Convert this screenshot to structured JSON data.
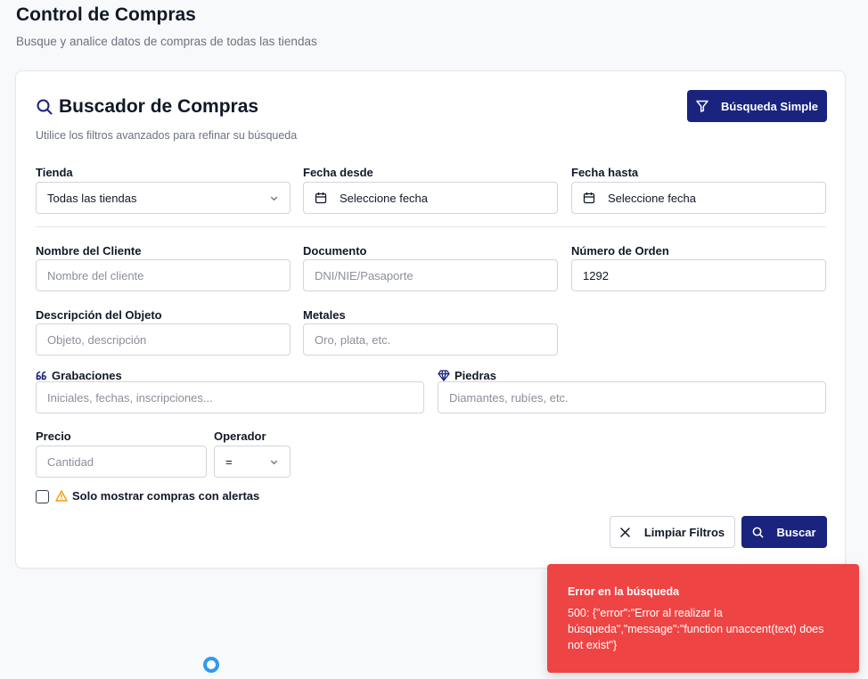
{
  "page": {
    "title": "Control de Compras",
    "subtitle": "Busque y analice datos de compras de todas las tiendas"
  },
  "search_card": {
    "title": "Buscador de Compras",
    "subtitle": "Utilice los filtros avanzados para refinar su búsqueda",
    "simple_search_label": "Búsqueda Simple"
  },
  "filters": {
    "tienda": {
      "label": "Tienda",
      "value": "Todas las tiendas"
    },
    "fecha_desde": {
      "label": "Fecha desde",
      "value": "Seleccione fecha"
    },
    "fecha_hasta": {
      "label": "Fecha hasta",
      "value": "Seleccione fecha"
    },
    "nombre_cliente": {
      "label": "Nombre del Cliente",
      "placeholder": "Nombre del cliente",
      "value": ""
    },
    "documento": {
      "label": "Documento",
      "placeholder": "DNI/NIE/Pasaporte",
      "value": ""
    },
    "numero_orden": {
      "label": "Número de Orden",
      "placeholder": "",
      "value": "1292"
    },
    "descripcion": {
      "label": "Descripción del Objeto",
      "placeholder": "Objeto, descripción",
      "value": ""
    },
    "metales": {
      "label": "Metales",
      "placeholder": "Oro, plata, etc.",
      "value": ""
    },
    "grabaciones": {
      "label": "Grabaciones",
      "placeholder": "Iniciales, fechas, inscripciones...",
      "value": "",
      "icon": "quote-icon"
    },
    "piedras": {
      "label": "Piedras",
      "placeholder": "Diamantes, rubíes, etc.",
      "value": "",
      "icon": "gem-icon"
    },
    "precio": {
      "label": "Precio",
      "placeholder": "Cantidad",
      "value": ""
    },
    "operador": {
      "label": "Operador",
      "value": "="
    },
    "alertas": {
      "label": "Solo mostrar compras con alertas",
      "checked": false,
      "icon": "warning-icon"
    }
  },
  "actions": {
    "clear_label": "Limpiar Filtros",
    "search_label": "Buscar"
  },
  "toast": {
    "title": "Error en la búsqueda",
    "message": "500: {\"error\":\"Error al realizar la búsqueda\",\"message\":\"function unaccent(text) does not exist\"}"
  },
  "colors": {
    "primary": "#1a237e",
    "error": "#ef4444",
    "warning": "#f59e0b",
    "spinner": "#2f9bf0"
  }
}
